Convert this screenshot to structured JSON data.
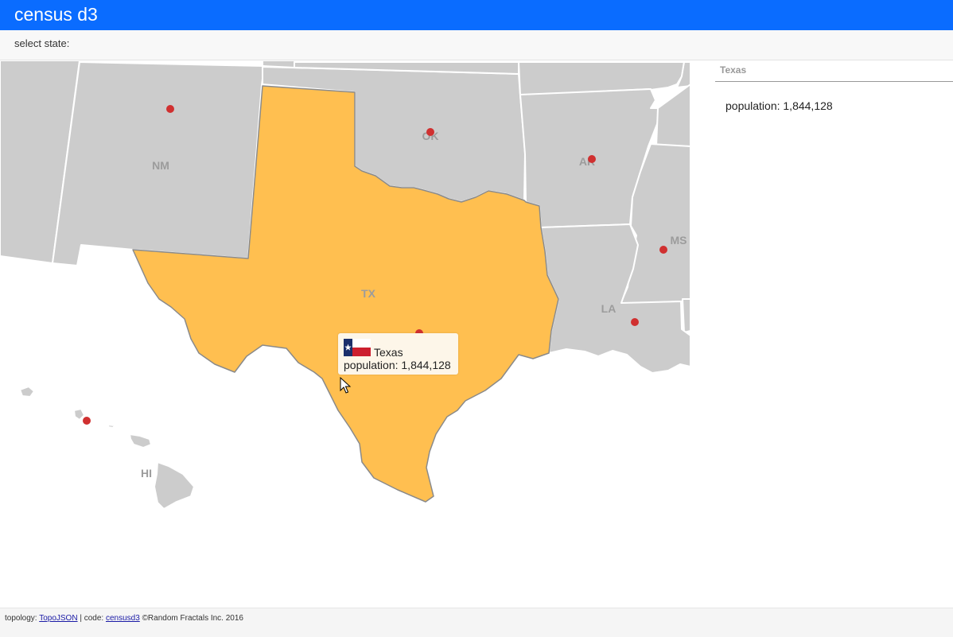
{
  "app": {
    "title": "census d3",
    "select_label": "select state:"
  },
  "map": {
    "selected_state": "TX",
    "highlight_color": "#ffbf50",
    "state_color": "#cccccc",
    "marker_color": "#d03030",
    "state_labels": {
      "nm": "NM",
      "ok": "OK",
      "ar": "AR",
      "ms": "MS",
      "la": "LA",
      "tx": "TX",
      "hi": "HI"
    }
  },
  "tooltip": {
    "flag_icon": "texas-flag-icon",
    "name": "Texas",
    "population_text": "population: 1,844,128"
  },
  "side_panel": {
    "title": "Texas",
    "population_text": "population: 1,844,128"
  },
  "footer": {
    "prefix": "topology:",
    "topojson_link": "TopoJSON",
    "separator": "| code:",
    "code_link": "censusd3",
    "copyright": "©Random Fractals Inc. 2016"
  }
}
